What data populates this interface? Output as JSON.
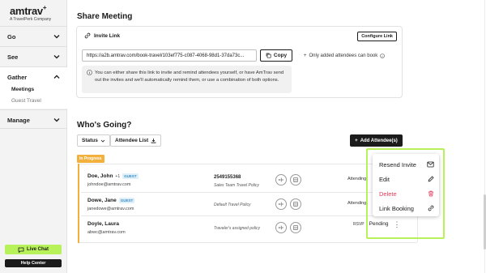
{
  "brand": {
    "name": "amtrav",
    "plus": "+",
    "tagline": "A TravelPerk Company"
  },
  "sidebar": {
    "items": [
      {
        "label": "Go"
      },
      {
        "label": "See"
      },
      {
        "label": "Gather"
      },
      {
        "label": "Manage"
      }
    ],
    "gather_sub": [
      "Meetings",
      "Guest Travel"
    ],
    "live_chat": "Live Chat",
    "help_center": "Help Center"
  },
  "share": {
    "title": "Share Meeting",
    "invite_link_label": "Invite Link",
    "configure_link": "Configure Link",
    "url": "https://a2b.amtrav.com/book-travel/103ef775-c087-4068-98d1-37da73c...",
    "copy_label": "Copy",
    "only_added": "Only added attendees can book",
    "info": "You can either share this link to invite and remind attendees yourself, or have AmTrav send out the invites and we'll automatically remind them, or use a combination of both options."
  },
  "going": {
    "title": "Who's Going?",
    "status_filter": "Status",
    "attendee_list": "Attendee List",
    "add_attendees": "Add Attendee(s)",
    "in_progress": "In Progress",
    "rows": [
      {
        "name": "Doe, John",
        "plus": "+1",
        "badge": "GUEST",
        "email": "johndoe@amtrav.com",
        "phone": "2549155368",
        "policy": "Sales Team Travel Policy",
        "status": "Attending"
      },
      {
        "name": "Dowe, Jane",
        "plus": "",
        "badge": "GUEST",
        "email": "janedowe@amtrav.com",
        "phone": "",
        "policy": "Default Travel Policy",
        "status": "Attending"
      },
      {
        "name": "Doyle, Laura",
        "plus": "",
        "badge": "",
        "email": "abwc@amtrav.com",
        "phone": "",
        "policy": "Traveler's assigned policy",
        "status": "RSVP Pending"
      }
    ],
    "rsvp_label": "RSVP",
    "pending_label": "Pending"
  },
  "menu": {
    "items": [
      {
        "label": "Resend Invite",
        "icon": "mail-icon"
      },
      {
        "label": "Edit",
        "icon": "pencil-icon"
      },
      {
        "label": "Delete",
        "icon": "trash-icon",
        "color": "#e03b5b"
      },
      {
        "label": "Link Booking",
        "icon": "link-icon"
      }
    ]
  },
  "colors": {
    "accent": "#b8f25a",
    "in_progress": "#f3b03d",
    "guest_badge": "#3a8dc4",
    "danger": "#e03b5b"
  }
}
